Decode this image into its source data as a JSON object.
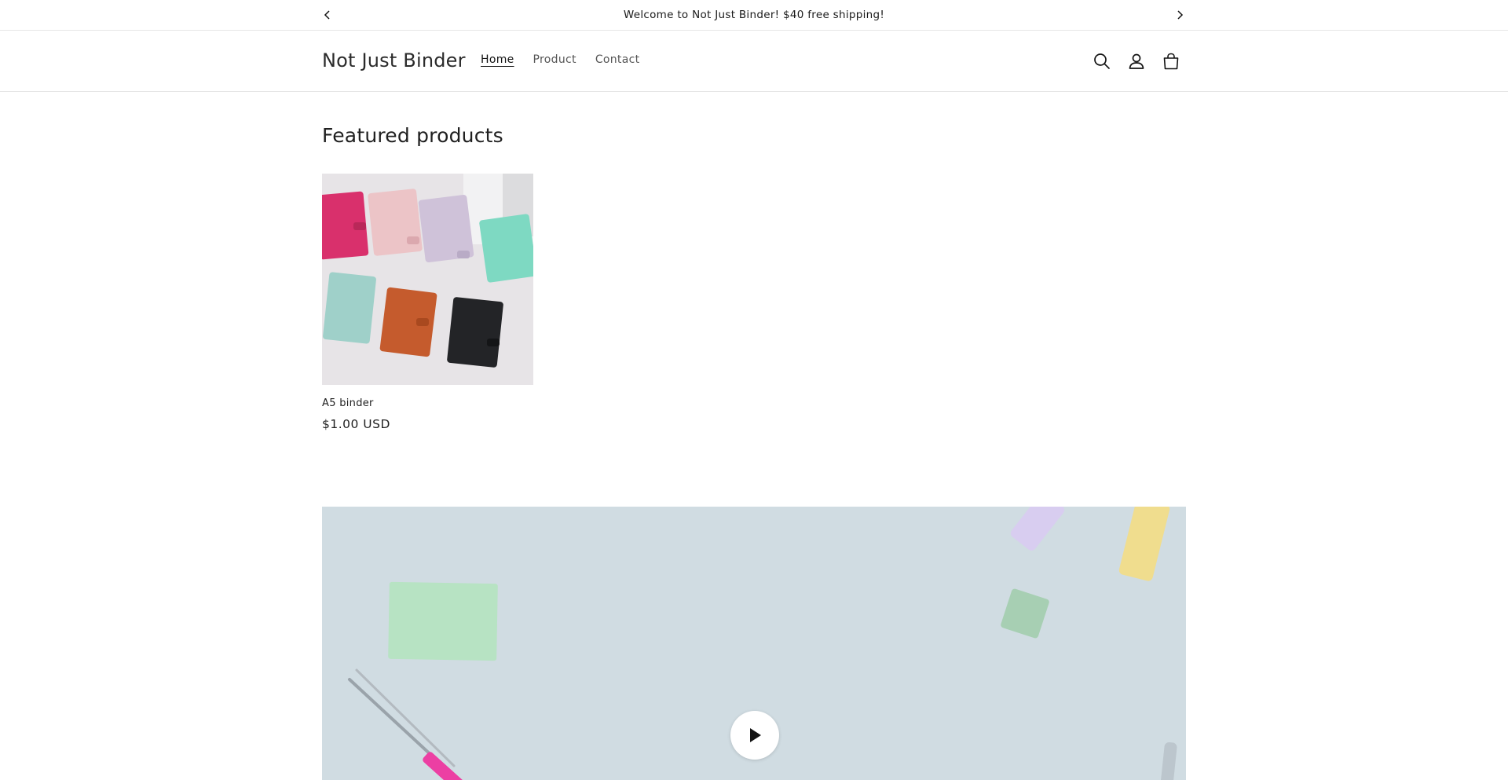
{
  "announcement": {
    "text": "Welcome to Not Just Binder! $40 free shipping!",
    "prev_icon": "chevron-left-icon",
    "next_icon": "chevron-right-icon"
  },
  "header": {
    "logo": "Not Just Binder",
    "nav": [
      {
        "label": "Home",
        "active": true
      },
      {
        "label": "Product",
        "active": false
      },
      {
        "label": "Contact",
        "active": false
      }
    ],
    "icons": [
      "search-icon",
      "account-icon",
      "cart-icon"
    ]
  },
  "featured": {
    "title": "Featured products",
    "products": [
      {
        "name": "A5 binder",
        "price": "$1.00 USD"
      }
    ]
  },
  "video": {
    "play_icon": "play-icon"
  }
}
